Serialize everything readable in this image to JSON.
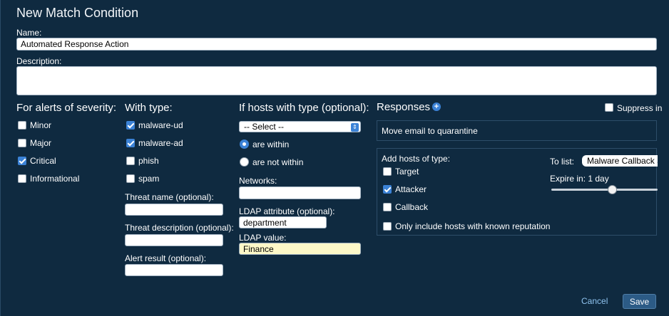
{
  "dialog": {
    "title": "New Match Condition"
  },
  "name": {
    "label": "Name:",
    "value": "Automated Response Action"
  },
  "description": {
    "label": "Description:",
    "value": ""
  },
  "severity": {
    "heading": "For alerts of severity:",
    "items": [
      {
        "label": "Minor",
        "checked": false
      },
      {
        "label": "Major",
        "checked": false
      },
      {
        "label": "Critical",
        "checked": true
      },
      {
        "label": "Informational",
        "checked": false
      }
    ]
  },
  "type": {
    "heading": "With type:",
    "items": [
      {
        "label": "malware-ud",
        "checked": true
      },
      {
        "label": "malware-ad",
        "checked": true
      },
      {
        "label": "phish",
        "checked": false
      },
      {
        "label": "spam",
        "checked": false
      }
    ],
    "threat_name_label": "Threat name (optional):",
    "threat_name_value": "",
    "threat_desc_label": "Threat description (optional):",
    "threat_desc_value": "",
    "alert_result_label": "Alert result (optional):",
    "alert_result_value": ""
  },
  "hosts": {
    "heading": "If hosts with type (optional):",
    "select_value": "-- Select --",
    "radio_within": "are within",
    "radio_not_within": "are not within",
    "networks_label": "Networks:",
    "networks_value": "",
    "ldap_attr_label": "LDAP attribute (optional):",
    "ldap_attr_value": "department",
    "ldap_value_label": "LDAP value:",
    "ldap_value_value": "Finance"
  },
  "responses": {
    "heading": "Responses",
    "suppress_label": "Suppress in",
    "response_item": "Move email to quarantine",
    "add_hosts_label": "Add hosts of type:",
    "host_types": [
      {
        "label": "Target",
        "checked": false
      },
      {
        "label": "Attacker",
        "checked": true
      },
      {
        "label": "Callback",
        "checked": false
      },
      {
        "label": "Only include hosts with known reputation",
        "checked": false
      }
    ],
    "to_list_label": "To list:",
    "to_list_value": "Malware Callback Si",
    "expire_label": "Expire in: 1 day"
  },
  "footer": {
    "cancel": "Cancel",
    "save": "Save"
  },
  "colors": {
    "background": "#0f2a40",
    "accent": "#3b82d6",
    "highlight_input": "#fdf8c8"
  }
}
